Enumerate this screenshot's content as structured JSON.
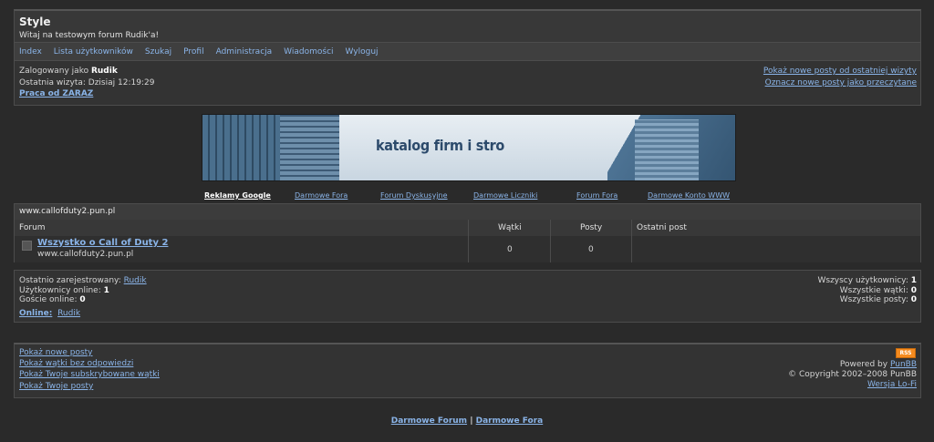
{
  "header": {
    "title": "Style",
    "description": "Witaj na testowym forum Rudik'a!"
  },
  "menu": {
    "items": [
      "Index",
      "Lista użytkowników",
      "Szukaj",
      "Profil",
      "Administracja",
      "Wiadomości",
      "Wyloguj"
    ]
  },
  "status": {
    "logged_prefix": "Zalogowany jako",
    "username": "Rudik",
    "last_visit": "Ostatnia wizyta: Dzisiaj 12:19:29",
    "job_link": "Praca od ZARAZ",
    "new_posts_link": "Pokaż nowe posty od ostatniej wizyty",
    "mark_read_link": "Oznacz nowe posty jako przeczytane"
  },
  "banner": {
    "text": "katalog firm i stro"
  },
  "ad_links": [
    "Reklamy Google",
    "Darmowe Fora",
    "Forum Dyskusyjne",
    "Darmowe Liczniki",
    "Forum Fora",
    "Darmowe Konto WWW"
  ],
  "forum_table": {
    "category": "www.callofduty2.pun.pl",
    "columns": [
      "Forum",
      "Wątki",
      "Posty",
      "Ostatni post"
    ],
    "rows": [
      {
        "name": "Wszystko o Call of Duty 2",
        "description": "www.callofduty2.pun.pl",
        "threads": "0",
        "posts": "0",
        "last_post": ""
      }
    ]
  },
  "stats": {
    "last_registered_label": "Ostatnio zarejestrowany:",
    "last_registered_user": "Rudik",
    "users_online_label": "Użytkownicy online:",
    "users_online": "1",
    "guests_online_label": "Goście online:",
    "guests_online": "0",
    "online_label": "Online:",
    "online_user": "Rudik",
    "total_users_label": "Wszyscy użytkownicy:",
    "total_users": "1",
    "total_threads_label": "Wszystkie wątki:",
    "total_threads": "0",
    "total_posts_label": "Wszystkie posty:",
    "total_posts": "0"
  },
  "footer": {
    "links": [
      "Pokaż nowe posty",
      "Pokaż wątki bez odpowiedzi",
      "Pokaż Twoje subskrybowane wątki",
      "Pokaż Twoje posty"
    ],
    "rss": "RSS",
    "powered_prefix": "Powered by",
    "powered_link": "PunBB",
    "copyright": "© Copyright 2002–2008 PunBB",
    "lofi_link": "Wersja Lo-Fi"
  },
  "bottom": {
    "link1": "Darmowe Forum",
    "separator": "|",
    "link2": "Darmowe Fora"
  }
}
